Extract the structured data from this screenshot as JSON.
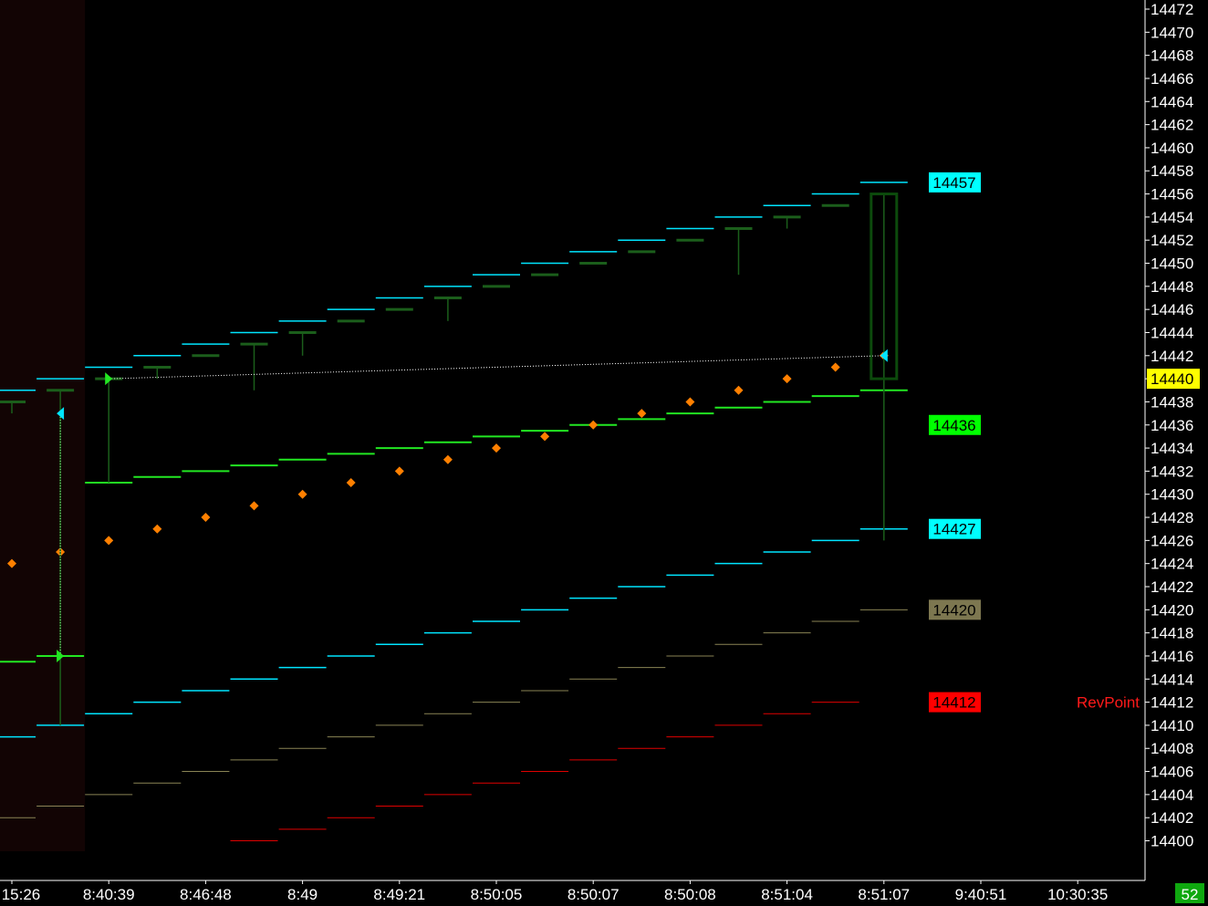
{
  "chart_data": {
    "type": "line",
    "title": "",
    "xlabel": "",
    "ylabel": "",
    "ylim": [
      14399,
      14473
    ],
    "grid": false,
    "y_ticks": [
      "14472",
      "14470",
      "14468",
      "14466",
      "14464",
      "14462",
      "14460",
      "14458",
      "14456",
      "14454",
      "14452",
      "14450",
      "14448",
      "14446",
      "14444",
      "14442",
      "14440",
      "14438",
      "14436",
      "14434",
      "14432",
      "14430",
      "14428",
      "14426",
      "14424",
      "14422",
      "14420",
      "14418",
      "14416",
      "14414",
      "14412",
      "14410",
      "14408",
      "14406",
      "14404",
      "14402",
      "14400"
    ],
    "x_tick_labels": [
      "15:26",
      "8:40:39",
      "8:46:48",
      "8:49",
      "8:49:21",
      "8:50:05",
      "8:50:07",
      "8:50:08",
      "8:51:04",
      "8:51:07",
      "9:40:51",
      "10:30:35"
    ],
    "series": [
      {
        "role": "upper-band",
        "color": "#00e5ff",
        "values": [
          14439,
          14440,
          14441,
          14442,
          14443,
          14444,
          14445,
          14446,
          14447,
          14448,
          14449,
          14450,
          14451,
          14452,
          14453,
          14454,
          14455,
          14456,
          14457
        ]
      },
      {
        "role": "mid-green",
        "color": "#22e822",
        "values": [
          14415.5,
          14416,
          14431,
          14431.5,
          14432,
          14432.5,
          14433,
          14433.5,
          14434,
          14434.5,
          14435,
          14435.5,
          14436,
          14436.5,
          14437,
          14437.5,
          14438,
          14438.5,
          14439
        ]
      },
      {
        "role": "lower-band",
        "color": "#00e5ff",
        "values": [
          14409,
          14410,
          14411,
          14412,
          14413,
          14414,
          14415,
          14416,
          14417,
          14418,
          14419,
          14420,
          14421,
          14422,
          14423,
          14424,
          14425,
          14426,
          14427
        ]
      },
      {
        "role": "olive-line",
        "color": "#8a8455",
        "values": [
          14402,
          14403,
          14404,
          14405,
          14406,
          14407,
          14408,
          14409,
          14410,
          14411,
          14412,
          14413,
          14414,
          14415,
          14416,
          14417,
          14418,
          14419,
          14420
        ]
      },
      {
        "role": "red-line",
        "color": "#e00000",
        "values": [
          null,
          null,
          null,
          null,
          null,
          14400,
          14401,
          14402,
          14403,
          14404,
          14405,
          14406,
          14407,
          14408,
          14409,
          14410,
          14411,
          14412
        ]
      },
      {
        "role": "dots",
        "color": "#ff8000",
        "values": [
          14424,
          14425,
          14426,
          14427,
          14428,
          14429,
          14430,
          14431,
          14432,
          14433,
          14434,
          14435,
          14436,
          14437,
          14438,
          14439,
          14440,
          14441,
          14442
        ]
      }
    ],
    "bars": [
      {
        "open": 14438,
        "high": 14438,
        "low": 14437,
        "close": 14438
      },
      {
        "open": 14439,
        "high": 14439,
        "low": 14410,
        "close": 14439
      },
      {
        "open": 14440,
        "high": 14440,
        "low": 14431,
        "close": 14440
      },
      {
        "open": 14441,
        "high": 14441,
        "low": 14440,
        "close": 14441
      },
      {
        "open": 14442,
        "high": 14442,
        "low": 14442,
        "close": 14442
      },
      {
        "open": 14443,
        "high": 14443,
        "low": 14439,
        "close": 14443
      },
      {
        "open": 14444,
        "high": 14444,
        "low": 14442,
        "close": 14444
      },
      {
        "open": 14445,
        "high": 14445,
        "low": 14445,
        "close": 14445
      },
      {
        "open": 14446,
        "high": 14446,
        "low": 14446,
        "close": 14446
      },
      {
        "open": 14447,
        "high": 14447,
        "low": 14445,
        "close": 14447
      },
      {
        "open": 14448,
        "high": 14448,
        "low": 14448,
        "close": 14448
      },
      {
        "open": 14449,
        "high": 14449,
        "low": 14449,
        "close": 14449
      },
      {
        "open": 14450,
        "high": 14450,
        "low": 14450,
        "close": 14450
      },
      {
        "open": 14451,
        "high": 14451,
        "low": 14451,
        "close": 14451
      },
      {
        "open": 14452,
        "high": 14452,
        "low": 14452,
        "close": 14452
      },
      {
        "open": 14453,
        "high": 14453,
        "low": 14449,
        "close": 14453
      },
      {
        "open": 14454,
        "high": 14454,
        "low": 14453,
        "close": 14454
      },
      {
        "open": 14455,
        "high": 14455,
        "low": 14455,
        "close": 14455
      },
      {
        "open": 14456,
        "high": 14456,
        "low": 14426,
        "close": 14440,
        "box": true
      }
    ],
    "markers": [
      {
        "index": 1,
        "price": 14437,
        "shape": "left-triangle",
        "color": "#00e5ff"
      },
      {
        "index": 1,
        "price": 14416,
        "shape": "right-triangle",
        "color": "#22e822"
      },
      {
        "index": 2,
        "price": 14440,
        "shape": "right-triangle",
        "color": "#22e822"
      },
      {
        "index": 18,
        "price": 14442,
        "shape": "left-triangle",
        "color": "#00e5ff"
      }
    ],
    "dotted_links": [
      {
        "from_index": 1,
        "from_price": 14416,
        "to_index": 1,
        "to_price": 14437,
        "color": "#99ff99"
      },
      {
        "from_index": 2,
        "from_price": 14440,
        "to_index": 18,
        "to_price": 14442,
        "color": "#ffffff"
      }
    ],
    "price_labels": [
      {
        "text": "14457",
        "value": 14457,
        "bg": "#00ffff",
        "fg": "#000000"
      },
      {
        "text": "14436",
        "value": 14436,
        "bg": "#00ff00",
        "fg": "#000000"
      },
      {
        "text": "14427",
        "value": 14427,
        "bg": "#00ffff",
        "fg": "#000000"
      },
      {
        "text": "14420",
        "value": 14420,
        "bg": "#7d7750",
        "fg": "#000000"
      },
      {
        "text": "14412",
        "value": 14412,
        "bg": "#ff0000",
        "fg": "#000000"
      }
    ],
    "current_price": {
      "text": "14440",
      "value": 14440,
      "bg": "#ffff00",
      "fg": "#000000"
    },
    "annotation": {
      "text": "RevPoint",
      "value": 14412,
      "color": "#ff1a1a"
    },
    "session_shading": {
      "color": "#120404",
      "until_index": 1
    },
    "corner_badge": {
      "text": "52",
      "bg": "#0fa80f",
      "fg": "#ffffff"
    }
  }
}
